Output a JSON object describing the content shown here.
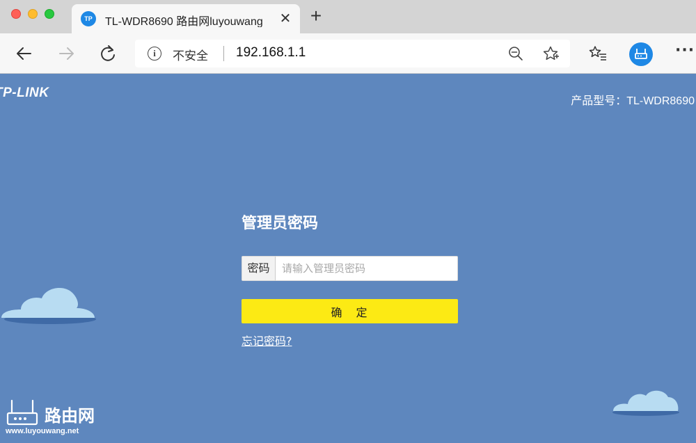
{
  "browser": {
    "tab": {
      "favicon_text": "TP",
      "title": "TL-WDR8690 路由网luyouwang",
      "close_glyph": "✕"
    },
    "new_tab_glyph": "+",
    "address_bar": {
      "security_label": "不安全",
      "url": "192.168.1.1"
    },
    "more_glyph": "···"
  },
  "page": {
    "brand": "TP-LINK",
    "model_label": "产品型号：TL-WDR8690",
    "login": {
      "title": "管理员密码",
      "password_label": "密码",
      "password_placeholder": "请输入管理员密码",
      "password_value": "",
      "confirm_label": "确　定",
      "forgot_link": "忘记密码?"
    },
    "watermark": {
      "name": "路由网",
      "url": "www.luyouwang.net"
    }
  },
  "colors": {
    "page_background": "#5e87be",
    "confirm_button": "#fcea14",
    "cloud": "#b8dcf2",
    "cloud_shadow": "#3f6aa6",
    "favicon": "#1e88e5"
  },
  "icons": {
    "back": "back-arrow-icon",
    "forward": "forward-arrow-icon",
    "reload": "reload-icon",
    "info": "info-icon",
    "zoom": "zoom-out-icon",
    "favorite": "star-icon",
    "favorites_list": "favorites-list-icon",
    "profile": "router-profile-icon",
    "more": "more-icon"
  }
}
